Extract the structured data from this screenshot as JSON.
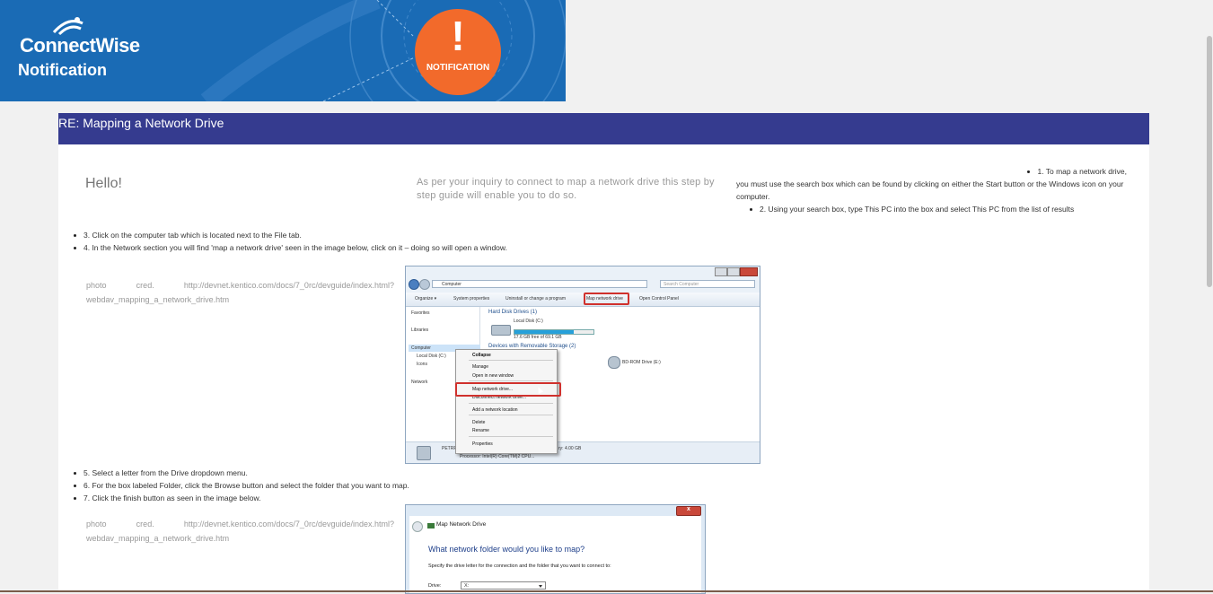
{
  "banner": {
    "brand": "ConnectWise",
    "subtitle": "Notification",
    "badge_mark": "!",
    "badge_label": "NOTIFICATION",
    "colors": {
      "background": "#1a6bb5",
      "badge": "#f26a2b"
    }
  },
  "email": {
    "subject": "RE: Mapping a Network Drive",
    "greeting": "Hello!",
    "intro": "As per your inquiry to connect to map a network drive this step by step guide will enable you to do so.",
    "steps_right": {
      "step1_head": "1. To map a network drive,",
      "step1_body": "you must use the search box which can be found by clicking on either the Start button or the Windows icon on your computer.",
      "step2": "2. Using your search box, type This PC into the box and select This PC from the list of results"
    },
    "steps_a": [
      "3. Click on the computer tab which is located next to the File tab.",
      "4. In the Network section you will find 'map a network drive' seen in the image below, click on it – doing so will open a window."
    ],
    "steps_b": [
      "5. Select a letter from the Drive dropdown menu.",
      "6. For the box labeled Folder, click the Browse button and select the folder that you want to map.",
      "7. Click the finish button as seen in the image below."
    ],
    "credit_1": "photo cred. http://devnet.kentico.com/docs/7_0rc/devguide/index.html?webdav_mapping_a_network_drive.htm",
    "credit_2": "photo cred. http://devnet.kentico.com/docs/7_0rc/devguide/index.html?webdav_mapping_a_network_drive.htm",
    "title_bar_color": "#353b8f"
  },
  "screenshot_explorer": {
    "address": "Computer",
    "search_placeholder": "Search Computer",
    "toolbar": [
      "Organize ▾",
      "System properties",
      "Uninstall or change a program",
      "Map network drive",
      "Open Control Panel"
    ],
    "nav": [
      "Favorites",
      "Libraries",
      "Computer",
      "Local Disk (C:)",
      "Icons",
      "Network"
    ],
    "group_hdd": "Hard Disk Drives (1)",
    "drive_c": "Local Disk (C:)",
    "drive_c_free": "17.6 GB free of 69.1 GB",
    "drive_c_used_fraction": 0.75,
    "group_removable": "Devices with Removable Storage (2)",
    "bd_drive": "BD-ROM Drive (E:)",
    "context_menu": [
      "Collapse",
      "Manage",
      "Open in new window",
      "Map network drive...",
      "Disconnect network drive...",
      "Add a network location",
      "Delete",
      "Rename",
      "Properties"
    ],
    "details_name": "PETRPE",
    "details_memory": "ry: 4.00 GB",
    "details_processor": "Processor: Intel(R) Core(TM)2 CPU..."
  },
  "screenshot_dialog": {
    "close_glyph": "x",
    "window_title": "Map Network Drive",
    "heading": "What network folder would you like to map?",
    "instruction": "Specify the drive letter for the connection and the folder that you want to connect to:",
    "drive_label": "Drive:",
    "drive_value": "X:"
  },
  "icons": [
    "connectwise-logo-icon",
    "exclamation-icon",
    "back-arrow-icon",
    "network-drive-icon"
  ]
}
